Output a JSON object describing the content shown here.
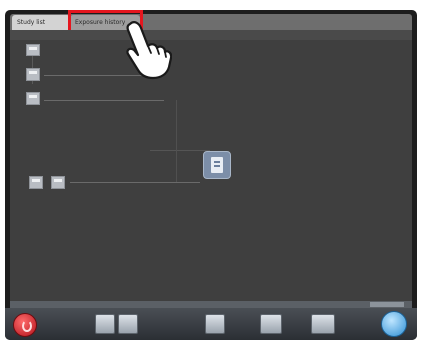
{
  "tabs": [
    {
      "label": "Study list"
    },
    {
      "label": "Exposure history"
    }
  ],
  "toolbar": {
    "power_icon": "power-icon",
    "next_icon": "next-icon"
  },
  "colors": {
    "highlight": "#e5161e",
    "panel": "#3f3f3f",
    "node": "#b9bdc3"
  }
}
